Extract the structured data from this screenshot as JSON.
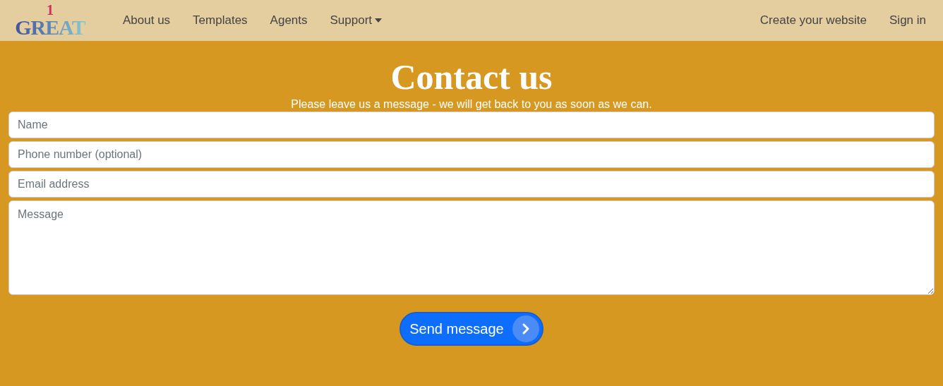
{
  "navbar": {
    "logo": {
      "word": "GREAT",
      "numeral": "1"
    },
    "items": [
      {
        "label": "About us",
        "kind": "link"
      },
      {
        "label": "Templates",
        "kind": "link"
      },
      {
        "label": "Agents",
        "kind": "link"
      },
      {
        "label": "Support",
        "kind": "dropdown"
      }
    ],
    "right_items": [
      {
        "label": "Create your website"
      },
      {
        "label": "Sign in"
      }
    ]
  },
  "contact": {
    "title": "Contact us",
    "subtitle": "Please leave us a message - we will get back to you as soon as we can.",
    "fields": [
      {
        "placeholder": "Name",
        "kind": "input"
      },
      {
        "placeholder": "Phone number (optional)",
        "kind": "input"
      },
      {
        "placeholder": "Email address",
        "kind": "input"
      },
      {
        "placeholder": "Message",
        "kind": "textarea"
      }
    ],
    "submit": {
      "label": "Send message"
    }
  }
}
